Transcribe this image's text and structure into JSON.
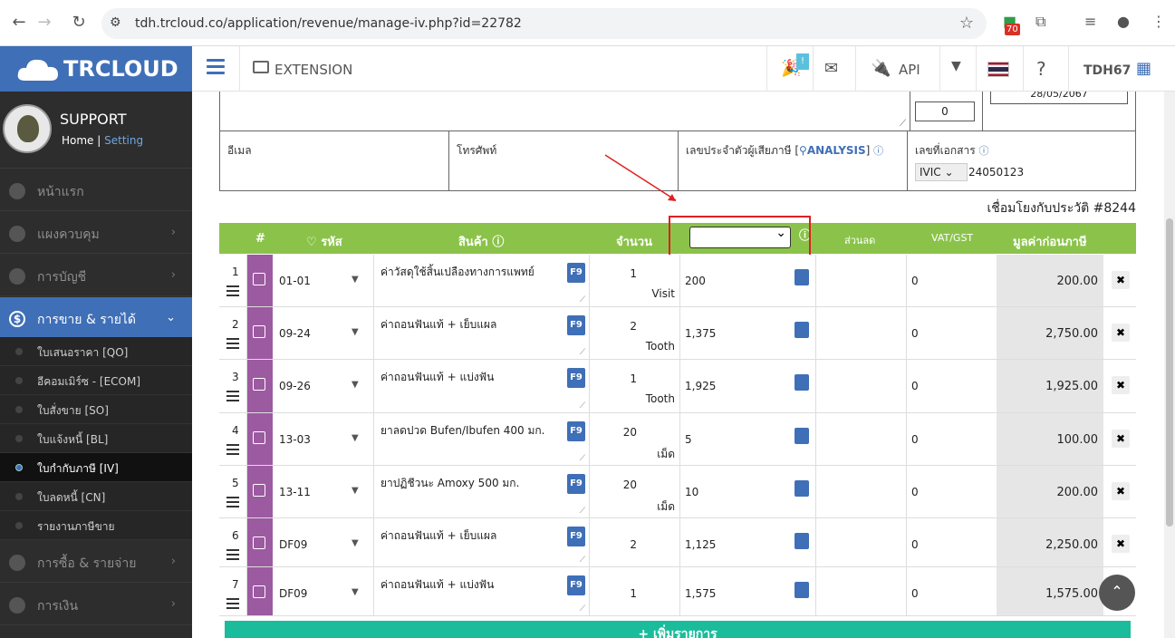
{
  "browser": {
    "url": "tdh.trcloud.co/application/revenue/manage-iv.php?id=22782",
    "badge": "70"
  },
  "brand": {
    "name": "TRCLOUD"
  },
  "topbar": {
    "extension": "EXTENSION",
    "notif": "!",
    "api": "API",
    "user": "TDH67"
  },
  "profile": {
    "name": "SUPPORT",
    "home": "Home",
    "sep": "|",
    "setting": "Setting"
  },
  "menu": [
    {
      "label": "หน้าแรก"
    },
    {
      "label": "แผงควบคุม",
      "chev": "›"
    },
    {
      "label": "การบัญชี",
      "chev": "›"
    },
    {
      "label": "การขาย & รายได้",
      "chev": "⌄",
      "icon": "$"
    },
    {
      "label": "การซื้อ & รายจ่าย",
      "chev": "›"
    },
    {
      "label": "การเงิน",
      "chev": "›"
    }
  ],
  "submenu": [
    "ใบเสนอราคา [QO]",
    "อีคอมเมิร์ซ - [ECOM]",
    "ใบสั่งขาย [SO]",
    "ใบแจ้งหนี้ [BL]",
    "ใบกำกับภาษี [IV]",
    "ใบลดหนี้ [CN]",
    "รายงานภาษีขาย"
  ],
  "info": {
    "zero_box": "0",
    "date": "28/05/2067",
    "email_label": "อีเมล",
    "phone_label": "โทรศัพท์",
    "taxid_label": "เลขประจำตัวผู้เสียภาษี [",
    "analysis": "ANALYSIS",
    "taxid_close": "]",
    "docno_label": "เลขที่เอกสาร",
    "doc_prefix": "IVIC",
    "doc_number": "24050123",
    "link_ref": "เชื่อมโยงกับประวัติ #8244"
  },
  "table": {
    "headers": {
      "num": "#",
      "code": "รหัส",
      "product": "สินค้า",
      "qty": "จำนวน",
      "discount": "ส่วนลด",
      "vat": "VAT/GST",
      "total": "มูลค่าก่อนภาษี"
    },
    "rows": [
      {
        "n": "1",
        "code": "01-01",
        "product": "ค่าวัสดุใช้สิ้นเปลืองทางการแพทย์",
        "qty": "1",
        "unit": "Visit",
        "price": "200",
        "disc": "0",
        "total": "200.00"
      },
      {
        "n": "2",
        "code": "09-24",
        "product": "ค่าถอนฟันแท้ + เย็บแผล",
        "qty": "2",
        "unit": "Tooth",
        "price": "1,375",
        "disc": "0",
        "total": "2,750.00"
      },
      {
        "n": "3",
        "code": "09-26",
        "product": "ค่าถอนฟันแท้ + แบ่งฟัน",
        "qty": "1",
        "unit": "Tooth",
        "price": "1,925",
        "disc": "0",
        "total": "1,925.00"
      },
      {
        "n": "4",
        "code": "13-03",
        "product": "ยาลดปวด Bufen/Ibufen 400 มก.",
        "qty": "20",
        "unit": "เม็ด",
        "price": "5",
        "disc": "0",
        "total": "100.00"
      },
      {
        "n": "5",
        "code": "13-11",
        "product": "ยาปฏิชีวนะ Amoxy 500 มก.",
        "qty": "20",
        "unit": "เม็ด",
        "price": "10",
        "disc": "0",
        "total": "200.00"
      },
      {
        "n": "6",
        "code": "DF09",
        "product": "ค่าถอนฟันแท้ + เย็บแผล",
        "qty": "2",
        "unit": "",
        "price": "1,125",
        "disc": "0",
        "total": "2,250.00"
      },
      {
        "n": "7",
        "code": "DF09",
        "product": "ค่าถอนฟันแท้ + แบ่งฟัน",
        "qty": "1",
        "unit": "",
        "price": "1,575",
        "disc": "0",
        "total": "1,575.00"
      }
    ],
    "f9": "F9",
    "add_button": "+ เพิ่มรายการ"
  }
}
